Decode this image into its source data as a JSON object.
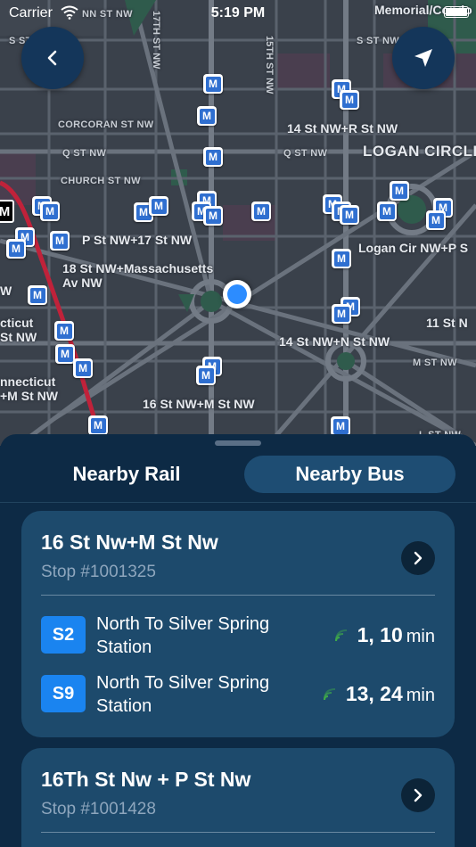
{
  "status_bar": {
    "carrier": "Carrier",
    "time": "5:19 PM"
  },
  "map": {
    "labels": {
      "corcoran": "CORCORAN ST NW",
      "q_st_left": "Q ST NW",
      "q_st_right": "Q ST NW",
      "church": "CHURCH ST NW",
      "s_st_top_left": "S ST NW",
      "s_st_top_right": "S ST NW",
      "nn_st": "NN ST NW",
      "memorial": "Memorial/Condo",
      "st_17_vert": "17TH ST NW",
      "st_15_vert": "15TH ST NW",
      "stop_14_r": "14 St NW+R St NW",
      "logan_circle": "LOGAN CIRCLE",
      "p_17": "P St NW+17 St NW",
      "logan_cir_p": "Logan Cir NW+P S",
      "mass_1": "18 St NW+Massachusetts",
      "mass_2": "Av NW",
      "conn_top_1": "cticut",
      "conn_top_2": "St NW",
      "st_11": "11 St N",
      "stop_14_n": "14 St NW+N St NW",
      "m_st": "M ST NW",
      "conn_bot_1": "nnecticut",
      "conn_bot_2": "+M St NW",
      "stop_16_m": "16 St NW+M St NW",
      "l_st": "L ST NW",
      "w_frag": "W"
    },
    "bus_marker_glyph": "M",
    "metro_marker_glyph": "M"
  },
  "buttons": {
    "back_icon": "chevron-left",
    "locate_icon": "location-arrow"
  },
  "tabs": {
    "rail": "Nearby Rail",
    "bus": "Nearby Bus",
    "active": "bus"
  },
  "stops": [
    {
      "name": "16 St Nw+M St Nw",
      "number": "Stop #1001325",
      "routes": [
        {
          "route": "S2",
          "dest": "North To Silver Spring Station",
          "times": "1, 10",
          "unit": "min"
        },
        {
          "route": "S9",
          "dest": "North To Silver Spring Station",
          "times": "13, 24",
          "unit": "min"
        }
      ]
    },
    {
      "name": "16Th St Nw + P St Nw",
      "number": "Stop #1001428"
    }
  ],
  "colors": {
    "accent": "#1a84f0",
    "sheet": "#0d2a45",
    "card": "#1d4a6c",
    "realtime": "#3ea84a"
  }
}
